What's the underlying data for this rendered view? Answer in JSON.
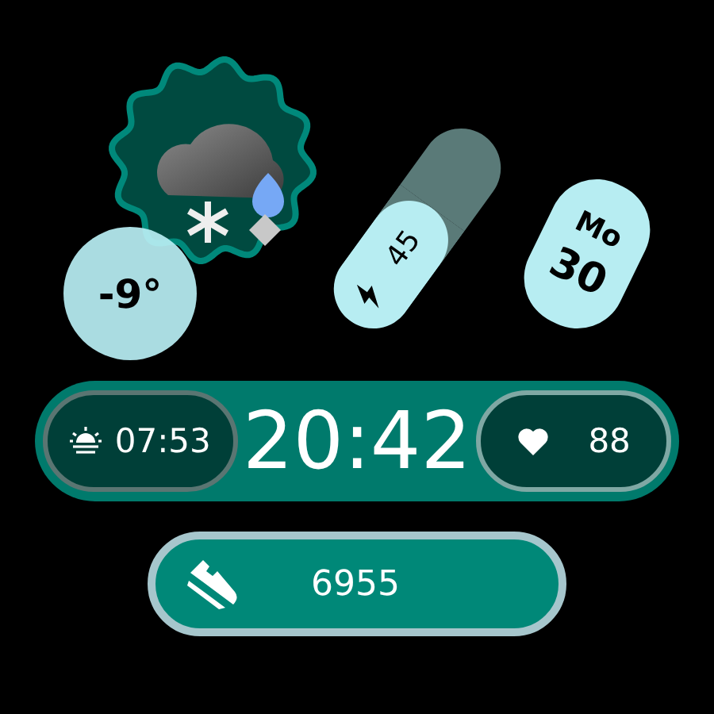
{
  "weather": {
    "temperature": "-9°"
  },
  "battery": {
    "value": "45"
  },
  "date": {
    "weekday": "Mo",
    "day": "30"
  },
  "sunrise": {
    "time": "07:53"
  },
  "time": "20:42",
  "heart_rate": {
    "value": "88"
  },
  "steps": {
    "value": "6955"
  }
}
